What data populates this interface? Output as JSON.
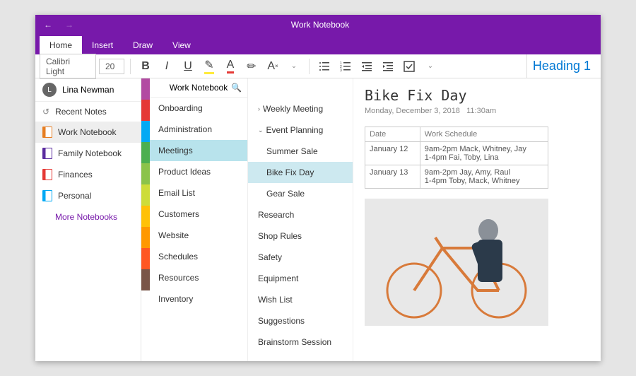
{
  "titlebar": {
    "title": "Work Notebook"
  },
  "tabs": {
    "items": [
      "Home",
      "Insert",
      "Draw",
      "View"
    ],
    "active": 0
  },
  "ribbon": {
    "font": "Calibri Light",
    "size": "20",
    "heading_style": "Heading 1"
  },
  "user": {
    "initial": "L",
    "name": "Lina Newman"
  },
  "sidebar": {
    "recent": "Recent Notes",
    "notebooks": [
      {
        "label": "Work Notebook",
        "color": "#e67e22",
        "selected": true
      },
      {
        "label": "Family Notebook",
        "color": "#5b2c9f",
        "selected": false
      },
      {
        "label": "Finances",
        "color": "#e53935",
        "selected": false
      },
      {
        "label": "Personal",
        "color": "#03a9f4",
        "selected": false
      }
    ],
    "more": "More Notebooks"
  },
  "section_header": "Work Notebook",
  "section_colors": [
    "#b24aa2",
    "#e53935",
    "#03a9f4",
    "#4caf50",
    "#8bc34a",
    "#cddc39",
    "#ffc107",
    "#ff9800",
    "#ff5722",
    "#795548"
  ],
  "sections": [
    "Onboarding",
    "Administration",
    "Meetings",
    "Product Ideas",
    "Email List",
    "Customers",
    "Website",
    "Schedules",
    "Resources",
    "Inventory"
  ],
  "sections_selected": 2,
  "pages": [
    {
      "label": "Weekly Meeting",
      "chev": ">",
      "sub": false
    },
    {
      "label": "Event Planning",
      "chev": "v",
      "sub": false
    },
    {
      "label": "Summer Sale",
      "sub": true
    },
    {
      "label": "Bike Fix Day",
      "sub": true,
      "selected": true
    },
    {
      "label": "Gear Sale",
      "sub": true
    },
    {
      "label": "Research",
      "sub": false
    },
    {
      "label": "Shop Rules",
      "sub": false
    },
    {
      "label": "Safety",
      "sub": false
    },
    {
      "label": "Equipment",
      "sub": false
    },
    {
      "label": "Wish List",
      "sub": false
    },
    {
      "label": "Suggestions",
      "sub": false
    },
    {
      "label": "Brainstorm Session",
      "sub": false
    }
  ],
  "page": {
    "title": "Bike Fix Day",
    "date": "Monday, December 3, 2018",
    "time": "11:30am",
    "table": {
      "headers": [
        "Date",
        "Work Schedule"
      ],
      "rows": [
        [
          "January 12",
          "9am-2pm Mack, Whitney, Jay\n1-4pm Fai, Toby, Lina"
        ],
        [
          "January 13",
          "9am-2pm Jay, Amy, Raul\n1-4pm Toby, Mack, Whitney"
        ]
      ]
    }
  }
}
